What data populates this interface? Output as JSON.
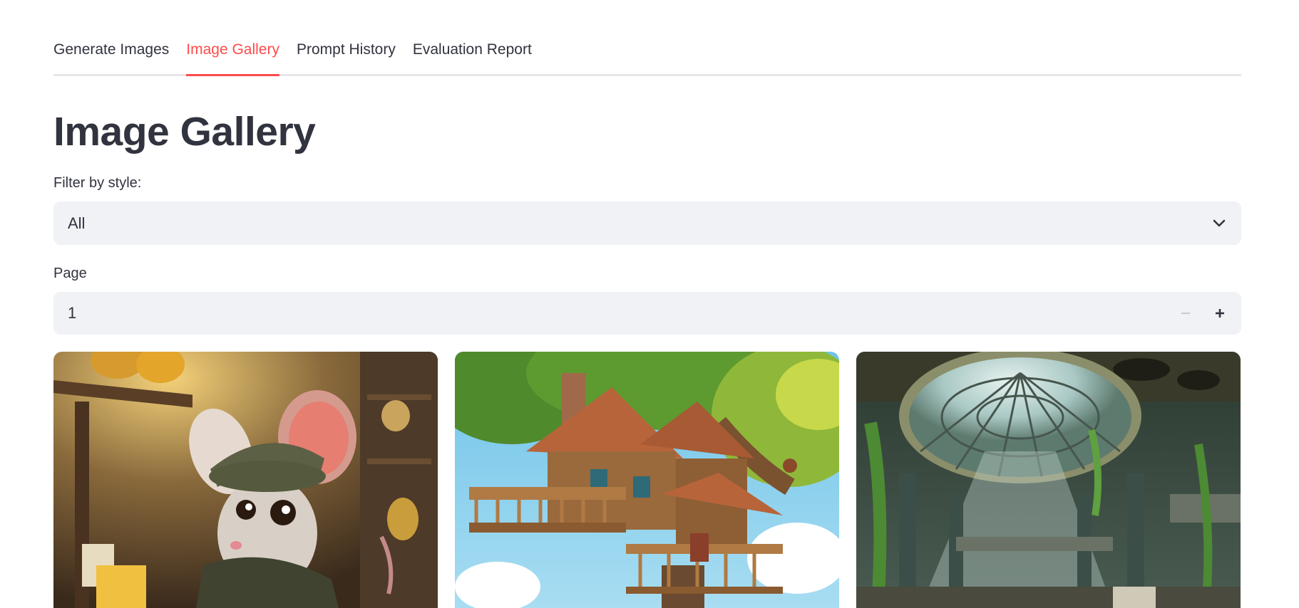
{
  "tabs": [
    {
      "label": "Generate Images",
      "active": false
    },
    {
      "label": "Image Gallery",
      "active": true
    },
    {
      "label": "Prompt History",
      "active": false
    },
    {
      "label": "Evaluation Report",
      "active": false
    }
  ],
  "page": {
    "title": "Image Gallery"
  },
  "filter": {
    "label": "Filter by style:",
    "selected": "All",
    "icon": "chevron-down-icon"
  },
  "pagination": {
    "label": "Page",
    "value": "1",
    "decrement_icon": "minus-icon",
    "increment_icon": "plus-icon"
  },
  "gallery": {
    "images": [
      {
        "subject": "mouse-in-pantry"
      },
      {
        "subject": "treehouse"
      },
      {
        "subject": "overgrown-glass-dome-hall"
      }
    ]
  },
  "colors": {
    "accent": "#ff4b4b",
    "text": "#31333f",
    "input_bg": "#f0f2f6"
  }
}
